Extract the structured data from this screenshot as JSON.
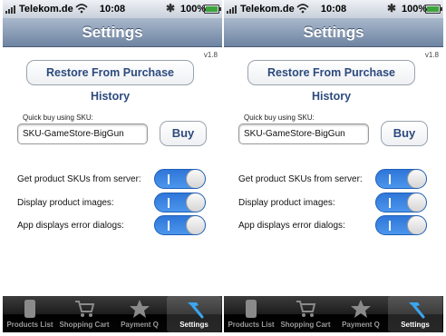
{
  "status_bar": {
    "carrier": "Telekom.de",
    "time": "10:08",
    "battery": "100%"
  },
  "nav": {
    "title": "Settings"
  },
  "version": "v1.8",
  "restore_button": "Restore From Purchase History",
  "quick_buy": {
    "label": "Quick buy using SKU:",
    "sku_value": "SKU-GameStore-BigGun",
    "buy_button": "Buy"
  },
  "settings": [
    {
      "label": "Get product SKUs from server:",
      "on": true
    },
    {
      "label": "Display product images:",
      "on": true
    },
    {
      "label": "App displays error dialogs:",
      "on": true
    }
  ],
  "tabs": [
    {
      "label": "Products List",
      "icon": "phone-icon"
    },
    {
      "label": "Shopping Cart",
      "icon": "cart-icon"
    },
    {
      "label": "Payment Q",
      "icon": "star-icon"
    },
    {
      "label": "Settings",
      "icon": "hammer-icon",
      "active": true
    }
  ],
  "colors": {
    "switch_on": "#3a86e3",
    "nav": "#6e84a2",
    "button_text": "#2c4a7e",
    "battery": "#3ca63c"
  }
}
